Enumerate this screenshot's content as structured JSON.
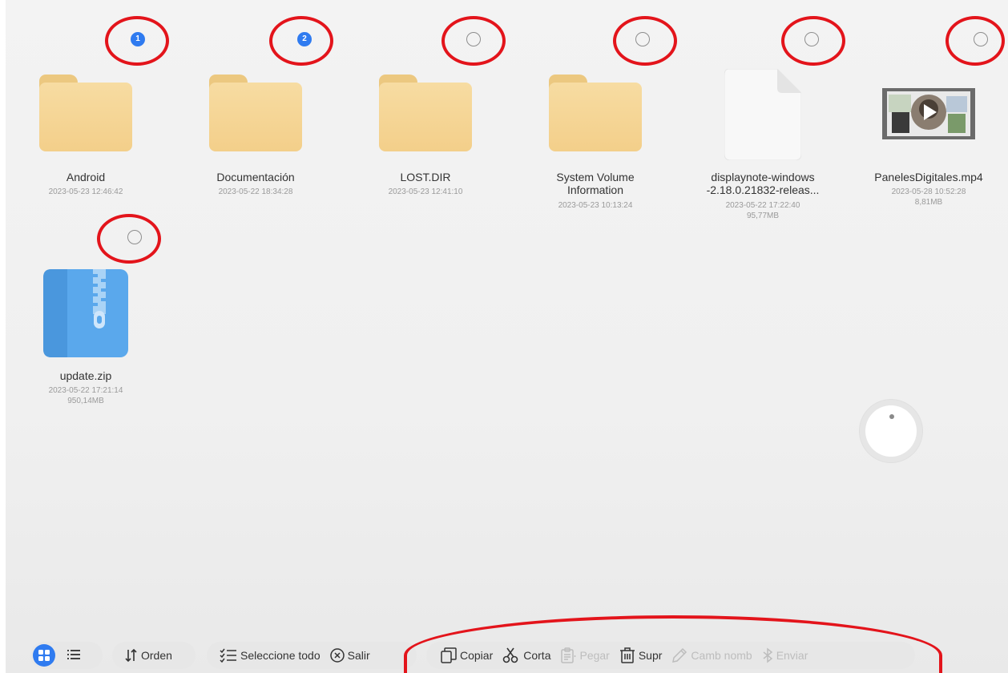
{
  "files": [
    {
      "name": "Android",
      "date": "2023-05-23  12:46:42",
      "size": "",
      "type": "folder",
      "selection_index": "1",
      "selected": true
    },
    {
      "name": "Documentación",
      "date": "2023-05-22  18:34:28",
      "size": "",
      "type": "folder",
      "selection_index": "2",
      "selected": true
    },
    {
      "name": "LOST.DIR",
      "date": "2023-05-23  12:41:10",
      "size": "",
      "type": "folder",
      "selection_index": "",
      "selected": false
    },
    {
      "name_line1": "System Volume",
      "name_line2": "Information",
      "date": "2023-05-23  10:13:24",
      "size": "",
      "type": "folder",
      "selection_index": "",
      "selected": false
    },
    {
      "name_line1": "displaynote-windows",
      "name_line2": "-2.18.0.21832-releas...",
      "date": "2023-05-22  17:22:40",
      "size": "95,77MB",
      "type": "document",
      "selection_index": "",
      "selected": false
    },
    {
      "name": "PanelesDigitales.mp4",
      "date": "2023-05-28  10:52:28",
      "size": "8,81MB",
      "type": "video",
      "selection_index": "",
      "selected": false
    },
    {
      "name": "update.zip",
      "date": "2023-05-22  17:21:14",
      "size": "950,14MB",
      "type": "zip",
      "selection_index": "",
      "selected": false
    }
  ],
  "toolbar": {
    "sort_label": "Orden",
    "select_all_label": "Seleccione todo",
    "exit_label": "Salir",
    "copy_label": "Copiar",
    "cut_label": "Corta",
    "paste_label": "Pegar",
    "delete_label": "Supr",
    "rename_label": "Camb nomb",
    "send_label": "Enviar"
  },
  "colors": {
    "accent": "#2f7bf0",
    "annotation": "#e3141b",
    "folder": "#f3cf8a",
    "zip": "#5aa8ec"
  },
  "icons": [
    "grid-view-icon",
    "list-view-icon",
    "sort-icon",
    "select-all-icon",
    "close-circle-icon",
    "copy-icon",
    "scissors-icon",
    "paste-icon",
    "trash-icon",
    "pencil-icon",
    "bluetooth-icon"
  ]
}
